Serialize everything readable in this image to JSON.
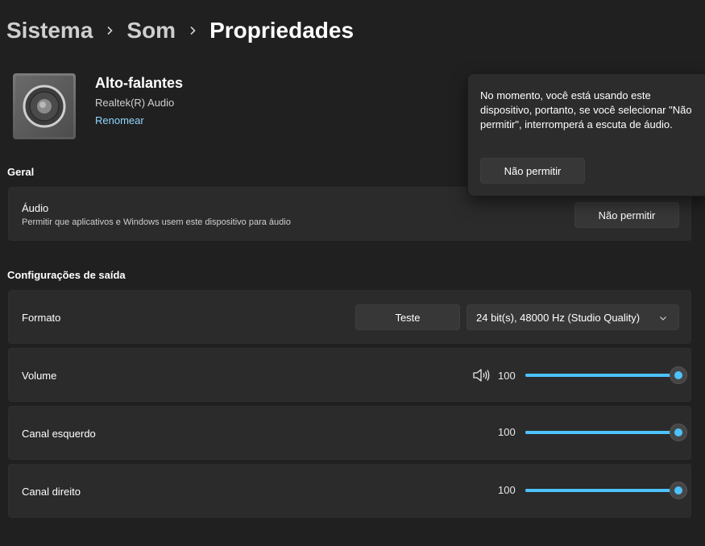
{
  "breadcrumb": [
    "Sistema",
    "Som",
    "Propriedades"
  ],
  "device": {
    "name": "Alto-falantes",
    "driver": "Realtek(R) Audio",
    "rename_link": "Renomear"
  },
  "general": {
    "section_title": "Geral",
    "audio_label": "Áudio",
    "audio_description": "Permitir que aplicativos e Windows usem este dispositivo para áudio",
    "audio_button": "Não permitir"
  },
  "output": {
    "section_title": "Configurações de saída",
    "format_label": "Formato",
    "test_button": "Teste",
    "format_value": "24 bit(s), 48000 Hz (Studio Quality)",
    "volume_label": "Volume",
    "volume_value": "100",
    "left_label": "Canal esquerdo",
    "left_value": "100",
    "right_label": "Canal direito",
    "right_value": "100",
    "volume_fraction": 1.0,
    "left_fraction": 1.0,
    "right_fraction": 1.0
  },
  "flyout": {
    "message": "No momento, você está usando este dispositivo, portanto, se você selecionar \"Não permitir\", interromperá a escuta de áudio.",
    "button": "Não permitir"
  },
  "icons": {
    "breadcrumb_separator": "chevron-right-icon",
    "device": "speaker-icon",
    "volume": "speaker-volume-icon",
    "dropdown": "chevron-down-icon"
  },
  "colors": {
    "accent": "#4cc2ff",
    "link": "#8fd6ff",
    "background": "#202020",
    "card": "#2b2b2b"
  }
}
